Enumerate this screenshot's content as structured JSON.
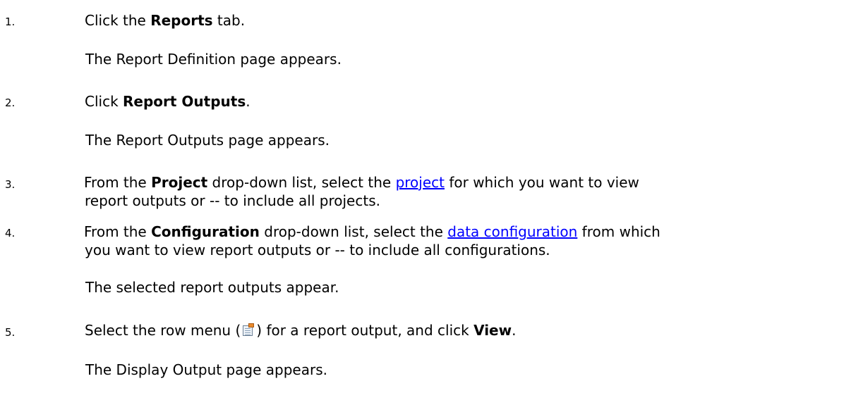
{
  "steps": [
    {
      "number": "1.",
      "before": "Click the ",
      "bold": "Reports",
      "after": " tab.",
      "result": "The Report Definition page appears."
    },
    {
      "number": "2.",
      "before": "Click ",
      "bold": "Report Outputs",
      "after": ".",
      "result": "The Report Outputs page appears."
    },
    {
      "number": "3.",
      "before": "From the ",
      "bold": "Project",
      "middle": " drop-down list, select the ",
      "link": "project",
      "after": " for which you want to view",
      "continuation": "report outputs or -- to include all projects."
    },
    {
      "number": "4.",
      "before": "From the ",
      "bold": "Configuration",
      "middle": " drop-down list, select the ",
      "link": "data configuration",
      "after": " from which",
      "continuation": "you want to view report outputs or -- to include all configurations.",
      "result": "The selected report outputs appear."
    },
    {
      "number": "5.",
      "before": "Select the row menu (",
      "icon": "row-menu-icon",
      "middle": ") for a report output, and click ",
      "bold": "View",
      "after": ".",
      "result": "The Display Output page appears."
    }
  ]
}
